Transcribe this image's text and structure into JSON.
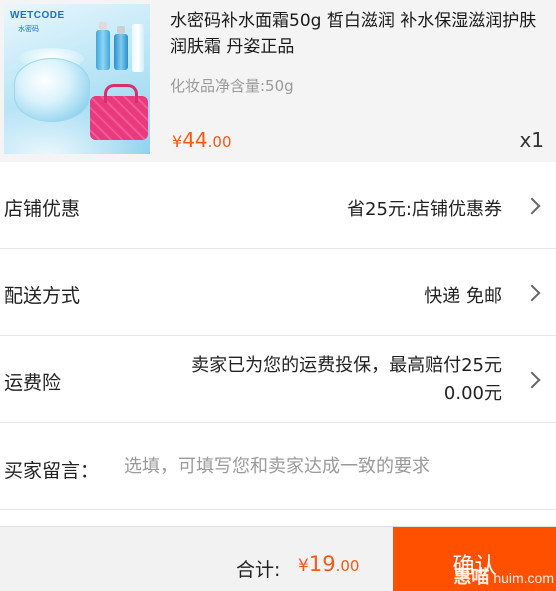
{
  "product": {
    "image_brand": "WETCODE",
    "image_brand_sub": "水密码",
    "title": "水密码补水面霜50g 皙白滋润 补水保湿滋润护肤润肤霜 丹姿正品",
    "spec": "化妆品净含量:50g",
    "price_currency": "¥",
    "price_int": "44",
    "price_dec": ".00",
    "quantity": "x1"
  },
  "rows": {
    "shop_discount": {
      "label": "店铺优惠",
      "value": "省25元:店铺优惠券"
    },
    "delivery": {
      "label": "配送方式",
      "value": "快递 免邮"
    },
    "insurance": {
      "label": "运费险",
      "value_line1": "卖家已为您的运费投保，最高赔付25元",
      "value_line2": "0.00元"
    },
    "message": {
      "label": "买家留言：",
      "placeholder": "选填，可填写您和卖家达成一致的要求",
      "value": ""
    }
  },
  "footer": {
    "total_label": "合计:",
    "total_currency": "¥",
    "total_int": "19",
    "total_dec": ".00",
    "confirm_label": "确认",
    "watermark_cn": "惠喵",
    "watermark_en": "huim.com"
  },
  "colors": {
    "accent": "#ff5000",
    "price": "#f25a16",
    "product_bg": "#f4f4f4",
    "divider": "#e6e6e6"
  },
  "icons": {
    "row_arrow": "chevron-right-icon"
  }
}
